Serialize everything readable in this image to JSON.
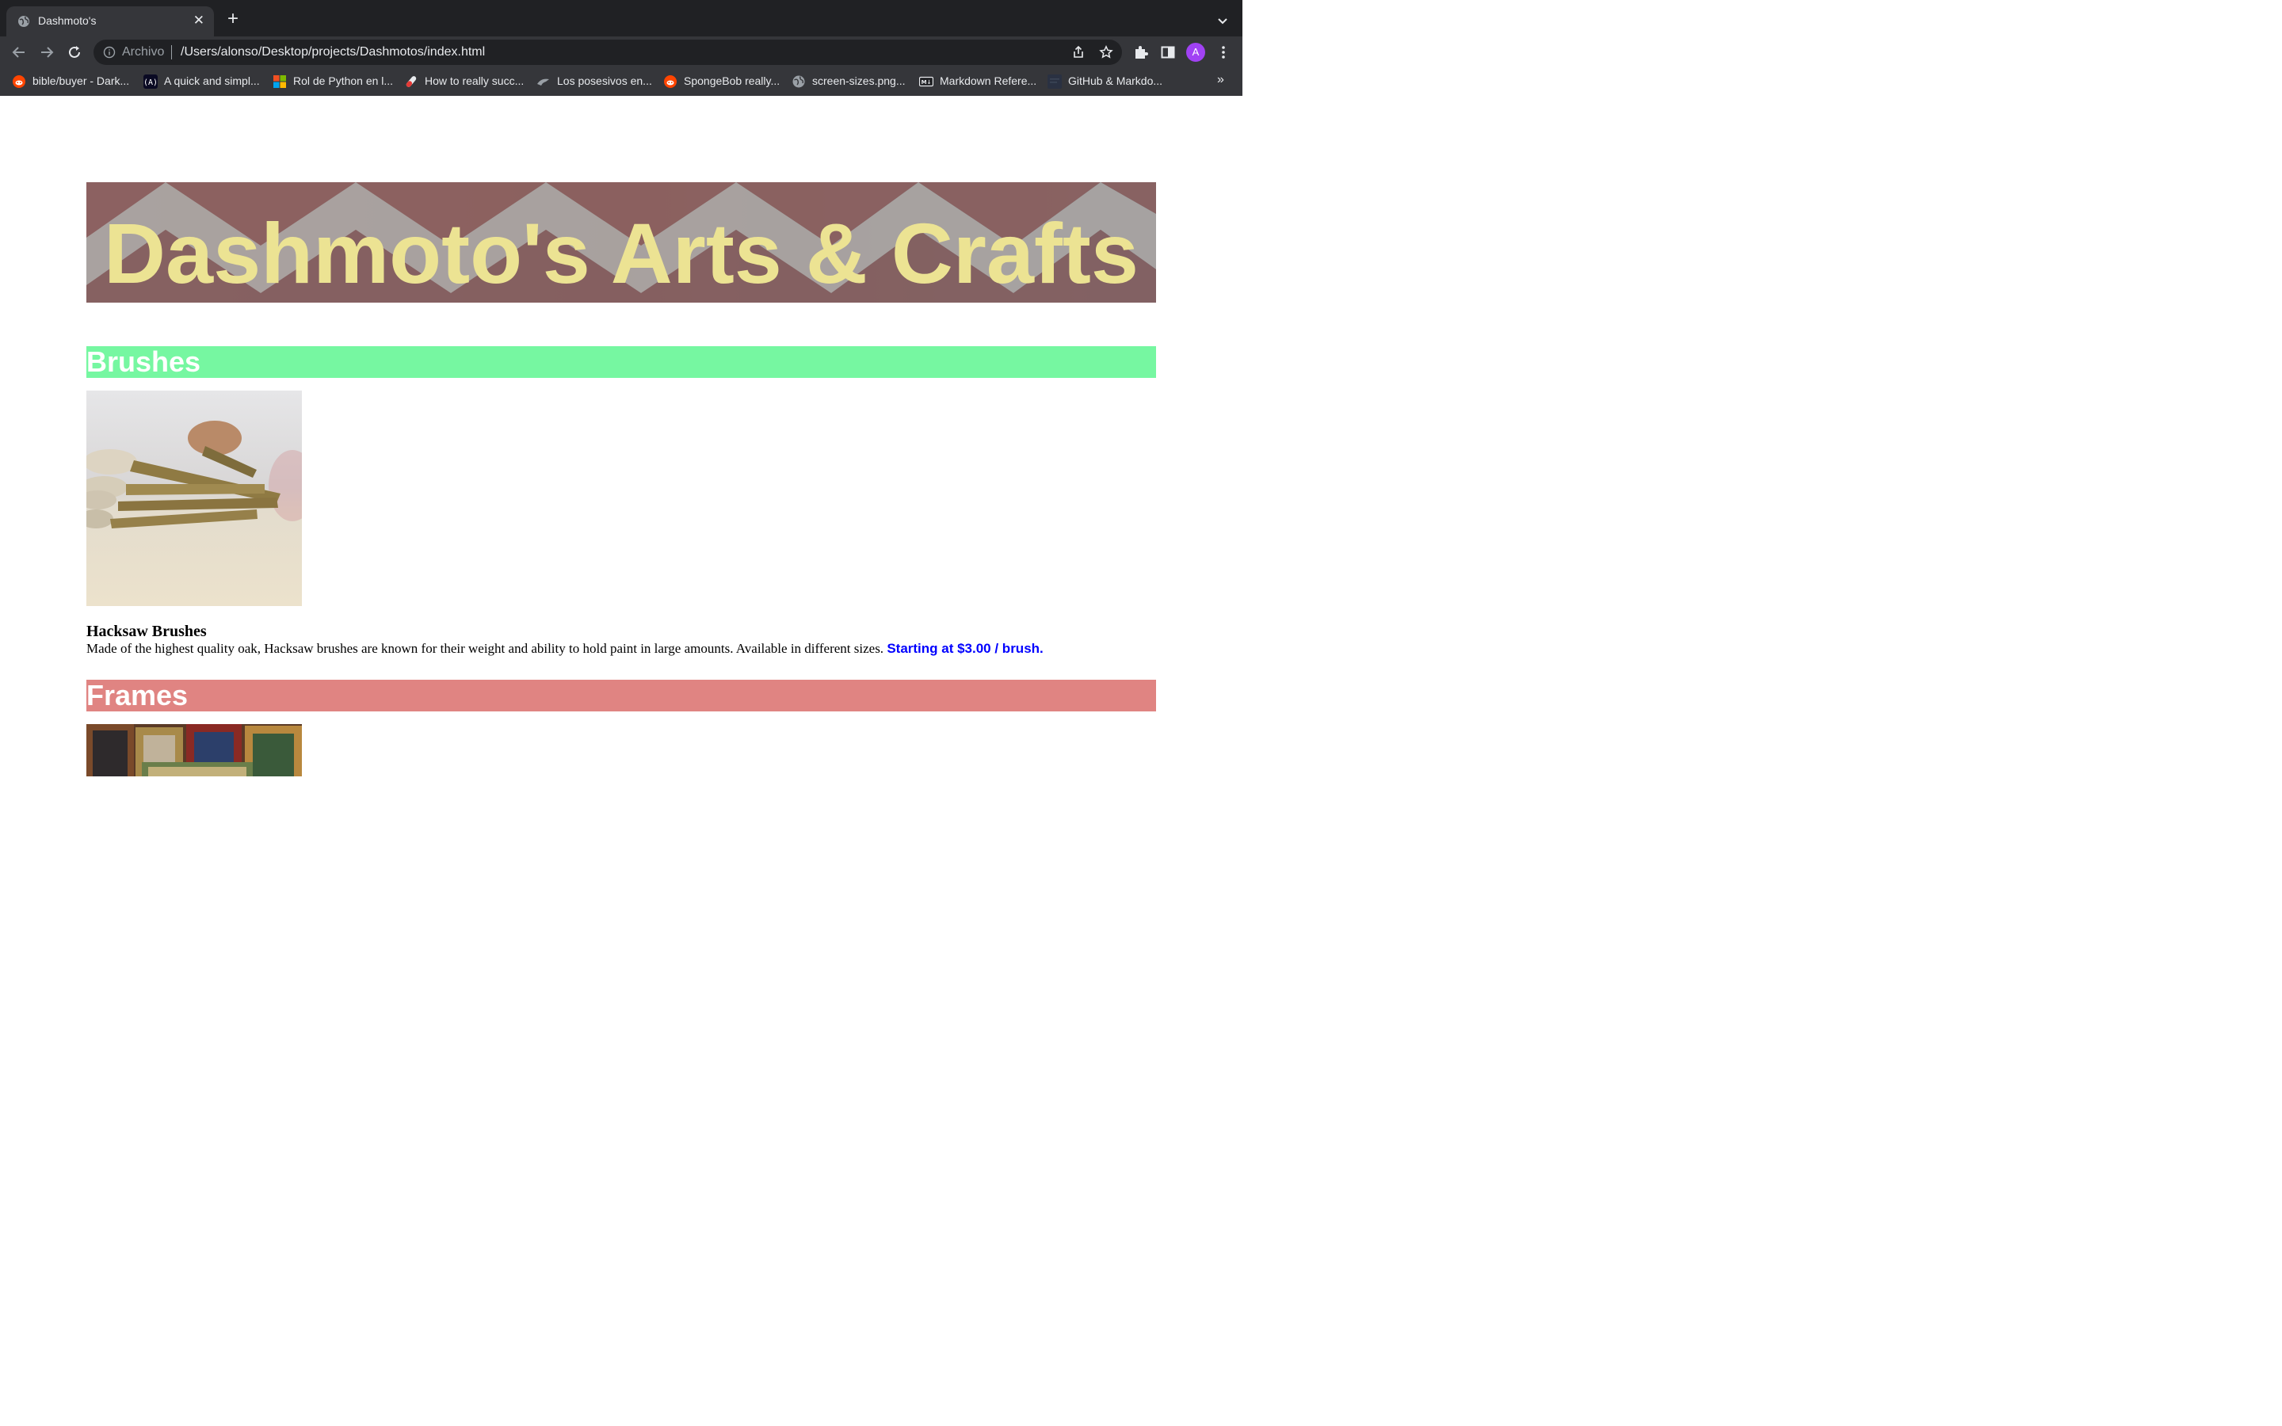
{
  "browser": {
    "tab_title": "Dashmoto's",
    "omnibox": {
      "scheme_label": "Archivo",
      "url": "/Users/alonso/Desktop/projects/Dashmotos/index.html"
    },
    "avatar_letter": "A",
    "bookmarks": [
      {
        "label": "bible/buyer - Dark...",
        "icon": "reddit-icon"
      },
      {
        "label": "A quick and simpl...",
        "icon": "freecodecamp-icon"
      },
      {
        "label": "Rol de Python en l...",
        "icon": "microsoft-icon"
      },
      {
        "label": "How to really succ...",
        "icon": "pill-icon"
      },
      {
        "label": "Los posesivos en...",
        "icon": "bird-icon"
      },
      {
        "label": "SpongeBob really...",
        "icon": "reddit-icon"
      },
      {
        "label": "screen-sizes.png...",
        "icon": "globe-icon"
      },
      {
        "label": "Markdown Refere...",
        "icon": "markdown-icon"
      },
      {
        "label": "GitHub & Markdo...",
        "icon": "github-icon"
      }
    ],
    "bookmarks_overflow": "»"
  },
  "page": {
    "banner_title": "Dashmoto's Arts & Crafts",
    "sections": [
      {
        "heading": "Brushes",
        "color": "#76f7a1",
        "product_name": "Hacksaw Brushes",
        "description": "Made of the highest quality oak, Hacksaw brushes are known for their weight and ability to hold paint in large amounts. Available in different sizes.",
        "price": "Starting at $3.00 / brush."
      },
      {
        "heading": "Frames",
        "color": "#e08482"
      }
    ]
  }
}
